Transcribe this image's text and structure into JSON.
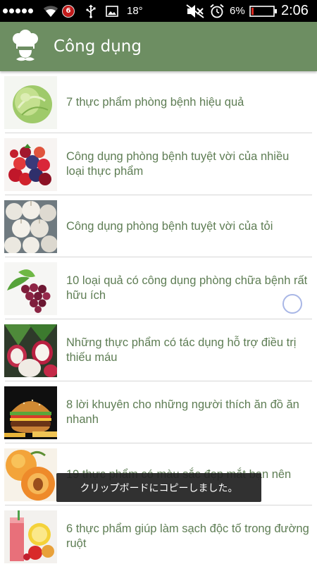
{
  "status_bar": {
    "notification_count": "6",
    "temperature": "18°",
    "battery_percent": "6%",
    "time": "2:06",
    "icons": [
      "signal-dots-icon",
      "wifi-icon",
      "notification-badge-icon",
      "usb-icon",
      "image-icon",
      "mute-icon",
      "alarm-icon",
      "battery-icon"
    ]
  },
  "header": {
    "title": "Công dụng",
    "icon": "chef-hat-icon",
    "background": "#6d8e62"
  },
  "articles": [
    {
      "title": "7 thực phẩm phòng bệnh hiệu quả",
      "thumbnail": "cabbage-image"
    },
    {
      "title": "Công dụng phòng bệnh tuyệt vời của nhiều loại thực phẩm",
      "thumbnail": "berries-image"
    },
    {
      "title": "Công dụng phòng bệnh tuyệt vời của tỏi",
      "thumbnail": "garlic-image"
    },
    {
      "title": "10 loại quả có công dụng phòng chữa bệnh rất hữu ích",
      "thumbnail": "grapes-image"
    },
    {
      "title": "Những thực phẩm có tác dụng hỗ trợ điều trị thiếu máu",
      "thumbnail": "radish-image"
    },
    {
      "title": "8 lời khuyên cho những người thích ăn đồ ăn nhanh",
      "thumbnail": "burger-image"
    },
    {
      "title": "19 thực phẩm có màu sắc đẹp mắt bạn nên",
      "thumbnail": "apricot-image"
    },
    {
      "title": "6 thực phẩm giúp làm sạch độc tố trong đường ruột",
      "thumbnail": "juice-image"
    }
  ],
  "toast": {
    "message": "クリップボードにコピーしました。"
  },
  "colors": {
    "accent": "#6d8e62",
    "item_text": "#5e7d54"
  }
}
